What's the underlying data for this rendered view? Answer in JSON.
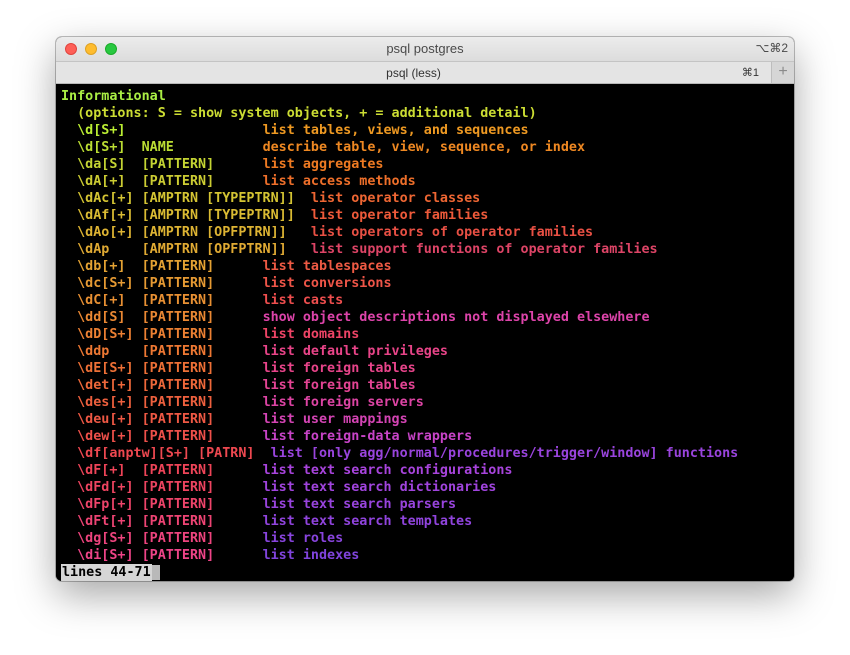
{
  "window": {
    "title": "psql postgres",
    "shortcut": "⌥⌘2"
  },
  "tabs": [
    {
      "label": "psql (less)",
      "shortcut": "⌘1"
    }
  ],
  "new_tab_glyph": "+",
  "terminal": {
    "lines": [
      {
        "text": "Informational",
        "color": "#aaee44"
      },
      {
        "text": "  (options: S = show system objects, + = additional detail)",
        "color": "#ccdd33"
      },
      {
        "cmd": "  \\d[S+]",
        "args": "",
        "desc": "list tables, views, and sequences",
        "cmd_color": "#bbee33",
        "desc_color": "#ee9922"
      },
      {
        "cmd": "  \\d[S+]",
        "args": "  NAME",
        "desc": "describe table, view, sequence, or index",
        "cmd_color": "#bbdd33",
        "desc_color": "#ee8822"
      },
      {
        "cmd": "  \\da[S]",
        "args": "  [PATTERN]",
        "desc": "list aggregates",
        "cmd_color": "#c4d433",
        "desc_color": "#ee7a22"
      },
      {
        "cmd": "  \\dA[+]",
        "args": "  [PATTERN]",
        "desc": "list access methods",
        "cmd_color": "#cccc33",
        "desc_color": "#ee6f2a"
      },
      {
        "cmd": "  \\dAc[+]",
        "args": " [AMPTRN [TYPEPTRN]]",
        "desc": "  list operator classes",
        "cmd_color": "#d4c433",
        "desc_color": "#ee6633"
      },
      {
        "cmd": "  \\dAf[+]",
        "args": " [AMPTRN [TYPEPTRN]]",
        "desc": "  list operator families",
        "cmd_color": "#dabb33",
        "desc_color": "#ee5a3a"
      },
      {
        "cmd": "  \\dAo[+]",
        "args": " [AMPTRN [OPFPTRN]]",
        "desc": "   list operators of operator families",
        "cmd_color": "#ddb333",
        "desc_color": "#e85044"
      },
      {
        "cmd": "  \\dAp",
        "args": "    [AMPTRN [OPFPTRN]]",
        "desc": "   list support functions of operator families",
        "cmd_color": "#e0aa33",
        "desc_color": "#dd4466"
      },
      {
        "cmd": "  \\db[+]",
        "args": "  [PATTERN]",
        "desc": "list tablespaces",
        "cmd_color": "#e4a233",
        "desc_color": "#ee5a44"
      },
      {
        "cmd": "  \\dc[S+]",
        "args": " [PATTERN]",
        "desc": "list conversions",
        "cmd_color": "#e69a33",
        "desc_color": "#ee5548"
      },
      {
        "cmd": "  \\dC[+]",
        "args": "  [PATTERN]",
        "desc": "list casts",
        "cmd_color": "#e89033",
        "desc_color": "#ee4e4e"
      },
      {
        "cmd": "  \\dd[S]",
        "args": "  [PATTERN]",
        "desc": "show object descriptions not displayed elsewhere",
        "cmd_color": "#ea8833",
        "desc_color": "#dd44aa"
      },
      {
        "cmd": "  \\dD[S+]",
        "args": " [PATTERN]",
        "desc": "list domains",
        "cmd_color": "#ec8033",
        "desc_color": "#ee4466"
      },
      {
        "cmd": "  \\ddp",
        "args": "    [PATTERN]",
        "desc": "list default privileges",
        "cmd_color": "#ee7833",
        "desc_color": "#e84488"
      },
      {
        "cmd": "  \\dE[S+]",
        "args": " [PATTERN]",
        "desc": "list foreign tables",
        "cmd_color": "#ee7036",
        "desc_color": "#e8448a"
      },
      {
        "cmd": "  \\det[+]",
        "args": " [PATTERN]",
        "desc": "list foreign tables",
        "cmd_color": "#ee683a",
        "desc_color": "#e44494"
      },
      {
        "cmd": "  \\des[+]",
        "args": " [PATTERN]",
        "desc": "list foreign servers",
        "cmd_color": "#ee603e",
        "desc_color": "#dd44a4"
      },
      {
        "cmd": "  \\deu[+]",
        "args": " [PATTERN]",
        "desc": "list user mappings",
        "cmd_color": "#ee5844",
        "desc_color": "#d444b4"
      },
      {
        "cmd": "  \\dew[+]",
        "args": " [PATTERN]",
        "desc": "list foreign-data wrappers",
        "cmd_color": "#ee504a",
        "desc_color": "#c844c8"
      },
      {
        "cmd": "  \\df[anptw][S+]",
        "args": " [PATRN]",
        "desc": " list [only agg/normal/procedures/trigger/window] functions",
        "cmd_color": "#ee4850",
        "desc_color": "#9944dd"
      },
      {
        "cmd": "  \\dF[+]",
        "args": "  [PATTERN]",
        "desc": "list text search configurations",
        "cmd_color": "#ee4458",
        "desc_color": "#a844dd"
      },
      {
        "cmd": "  \\dFd[+]",
        "args": " [PATTERN]",
        "desc": "list text search dictionaries",
        "cmd_color": "#ee4460",
        "desc_color": "#a044dd"
      },
      {
        "cmd": "  \\dFp[+]",
        "args": " [PATTERN]",
        "desc": "list text search parsers",
        "cmd_color": "#ee446a",
        "desc_color": "#9844dd"
      },
      {
        "cmd": "  \\dFt[+]",
        "args": " [PATTERN]",
        "desc": "list text search templates",
        "cmd_color": "#ee4474",
        "desc_color": "#9044dd"
      },
      {
        "cmd": "  \\dg[S+]",
        "args": " [PATTERN]",
        "desc": "list roles",
        "cmd_color": "#ee447e",
        "desc_color": "#8844dd"
      },
      {
        "cmd": "  \\di[S+]",
        "args": " [PATTERN]",
        "desc": "list indexes",
        "cmd_color": "#ee4488",
        "desc_color": "#8044dd"
      }
    ],
    "status": "lines 44-71"
  }
}
